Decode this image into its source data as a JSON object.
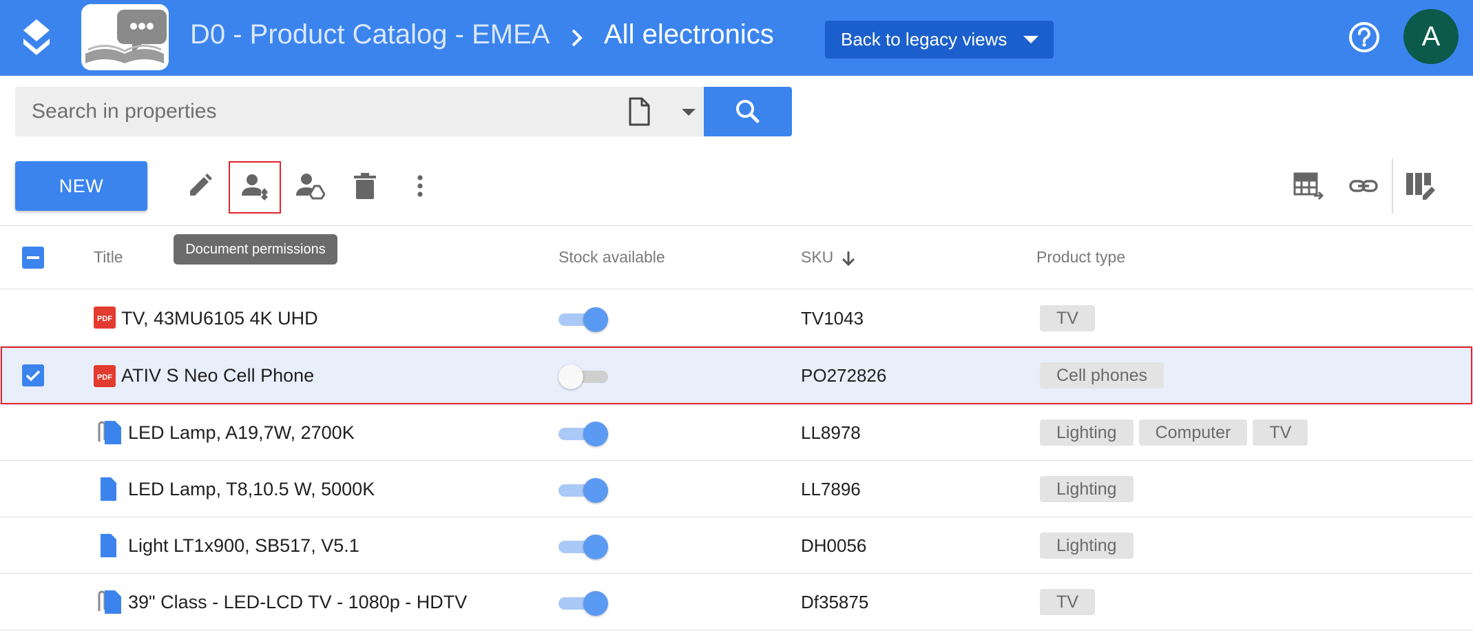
{
  "header": {
    "breadcrumb_parent": "D0 - Product Catalog - EMEA",
    "breadcrumb_current": "All electronics",
    "legacy_button_label": "Back to legacy views",
    "avatar_letter": "A"
  },
  "search": {
    "placeholder": "Search in properties",
    "value": ""
  },
  "toolbar": {
    "new_label": "NEW",
    "tooltip": "Document permissions",
    "icons": [
      "edit-icon",
      "document-permissions-icon",
      "share-drive-icon",
      "delete-icon",
      "more-vert-icon",
      "export-table-icon",
      "copy-link-icon",
      "edit-columns-icon"
    ]
  },
  "table": {
    "columns": {
      "title": "Title",
      "stock": "Stock available",
      "sku": "SKU",
      "product_type": "Product type"
    },
    "sort": {
      "column": "SKU",
      "direction": "descending"
    },
    "rows": [
      {
        "title": "TV, 43MU6105 4K UHD",
        "file_icon": "pdf-icon",
        "stock_available": true,
        "sku": "TV1043",
        "product_type": [
          "TV"
        ],
        "selected": false
      },
      {
        "title": "ATIV S Neo Cell Phone",
        "file_icon": "pdf-icon",
        "stock_available": false,
        "sku": "PO272826",
        "product_type": [
          "Cell phones"
        ],
        "selected": true
      },
      {
        "title": "LED Lamp, A19,7W, 2700K",
        "file_icon": "attachment-document-icon",
        "stock_available": true,
        "sku": "LL8978",
        "product_type": [
          "Lighting",
          "Computer",
          "TV"
        ],
        "selected": false
      },
      {
        "title": "LED Lamp, T8,10.5 W, 5000K",
        "file_icon": "document-icon",
        "stock_available": true,
        "sku": "LL7896",
        "product_type": [
          "Lighting"
        ],
        "selected": false
      },
      {
        "title": "Light LT1x900, SB517, V5.1",
        "file_icon": "document-icon",
        "stock_available": true,
        "sku": "DH0056",
        "product_type": [
          "Lighting"
        ],
        "selected": false
      },
      {
        "title": "39\" Class - LED-LCD TV - 1080p - HDTV",
        "file_icon": "attachment-document-icon",
        "stock_available": true,
        "sku": "Df35875",
        "product_type": [
          "TV"
        ],
        "selected": false
      }
    ]
  },
  "colors": {
    "header_bg": "#3b84ee",
    "legacy_button_bg": "#1b5fcc",
    "avatar_bg": "#0b5a4a",
    "highlight": "#e0242b",
    "selected_row_bg": "#e8effb"
  }
}
